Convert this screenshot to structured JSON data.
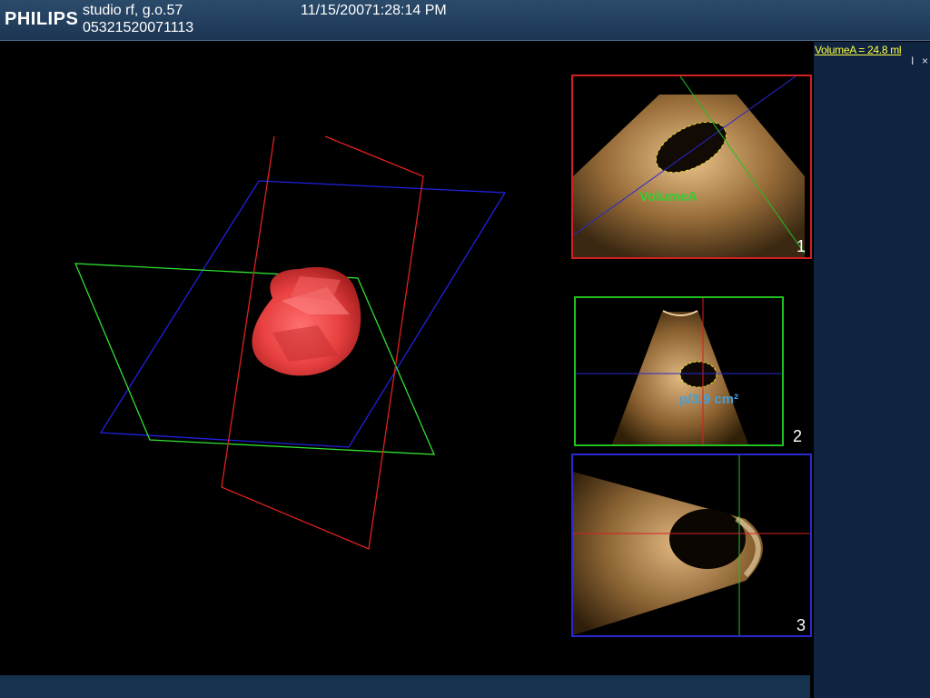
{
  "header": {
    "logo": "PHILIPS",
    "study_name": "studio rf, g.o.57",
    "study_id": "05321520071113",
    "datetime": "11/15/20071:28:14 PM"
  },
  "side_panel": {
    "volume_label": "VolumeA = 24.8 ml",
    "cursor_icon": "text-cursor-icon",
    "close_icon_glyph": "×"
  },
  "views": [
    {
      "number": "1",
      "frame_color": "#d42020",
      "annotation": "VolumeA",
      "annotation_color": "#30d030"
    },
    {
      "number": "2",
      "frame_color": "#20c020",
      "annotation": "p/3.9 cm²",
      "annotation_color": "#3fa0e0"
    },
    {
      "number": "3",
      "frame_color": "#2828d0"
    }
  ],
  "render_3d": {
    "plane_colors": {
      "red": "#e02020",
      "green": "#30e030",
      "blue": "#2020e0"
    },
    "object_color": "#e84848"
  }
}
